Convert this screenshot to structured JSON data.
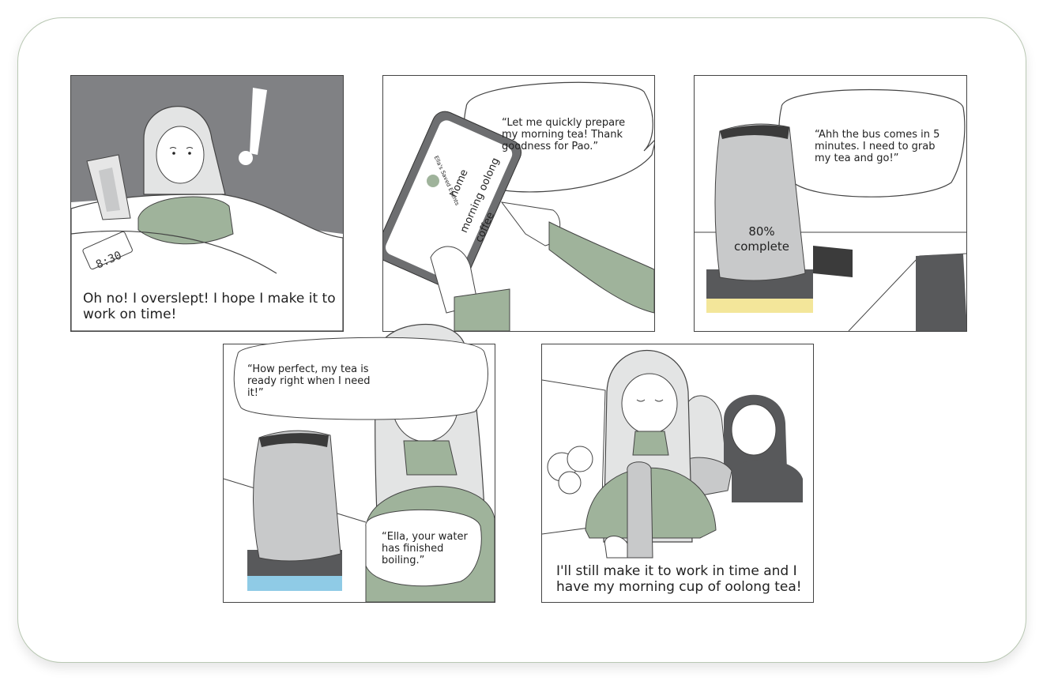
{
  "panels": {
    "p1": {
      "caption": "Oh no! I overslept! I hope I make it to work on time!",
      "clock": "8:30"
    },
    "p2": {
      "speech": "“Let me quickly prepare my morning tea! Thank goodness for Pao.”",
      "app_title": "Ella's Saved Events",
      "list_items": [
        "home",
        "morning oolong",
        "coffee"
      ]
    },
    "p3": {
      "speech": "“Ahh the bus comes in 5 minutes. I need to grab my tea and go!”",
      "progress_label": "80% complete",
      "progress": 0.8
    },
    "p4": {
      "speech_top": "“How perfect, my tea is ready right when I need it!”",
      "speech_bottom": "“Ella, your water has finished boiling.”"
    },
    "p5": {
      "caption": "I'll still make it to work in time and I have my morning cup of oolong tea!"
    }
  },
  "colors": {
    "wall": "#808184",
    "sweater": "#9fb39b",
    "kettle": "#c8c9ca",
    "base_dark": "#58595b",
    "ring_heating": "#f3e69a",
    "ring_done": "#8fcbe6",
    "outline": "#3b3b3b"
  }
}
